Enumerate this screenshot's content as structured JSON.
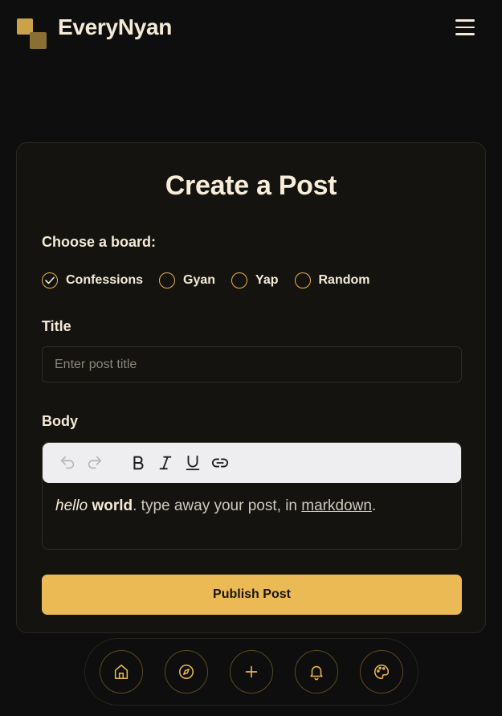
{
  "header": {
    "brand_name": "EveryNyan"
  },
  "form": {
    "title": "Create a Post",
    "board_label": "Choose a board:",
    "boards": [
      {
        "label": "Confessions",
        "selected": true
      },
      {
        "label": "Gyan",
        "selected": false
      },
      {
        "label": "Yap",
        "selected": false
      },
      {
        "label": "Random",
        "selected": false
      }
    ],
    "title_label": "Title",
    "title_placeholder": "Enter post title",
    "body_label": "Body",
    "body_content": {
      "italic": "hello",
      "bold": "world",
      "text1": ". type away your post, in ",
      "underline": "markdown",
      "text2": "."
    },
    "publish_label": "Publish Post"
  },
  "toolbar": {
    "icons": [
      "undo-icon",
      "redo-icon",
      "bold-icon",
      "italic-icon",
      "underline-icon",
      "link-icon"
    ]
  },
  "bottom_nav": {
    "icons": [
      "home-icon",
      "compass-icon",
      "plus-icon",
      "bell-icon",
      "palette-icon"
    ]
  },
  "colors": {
    "accent": "#ecba55",
    "background": "#0e0e0e",
    "card": "#141310"
  }
}
